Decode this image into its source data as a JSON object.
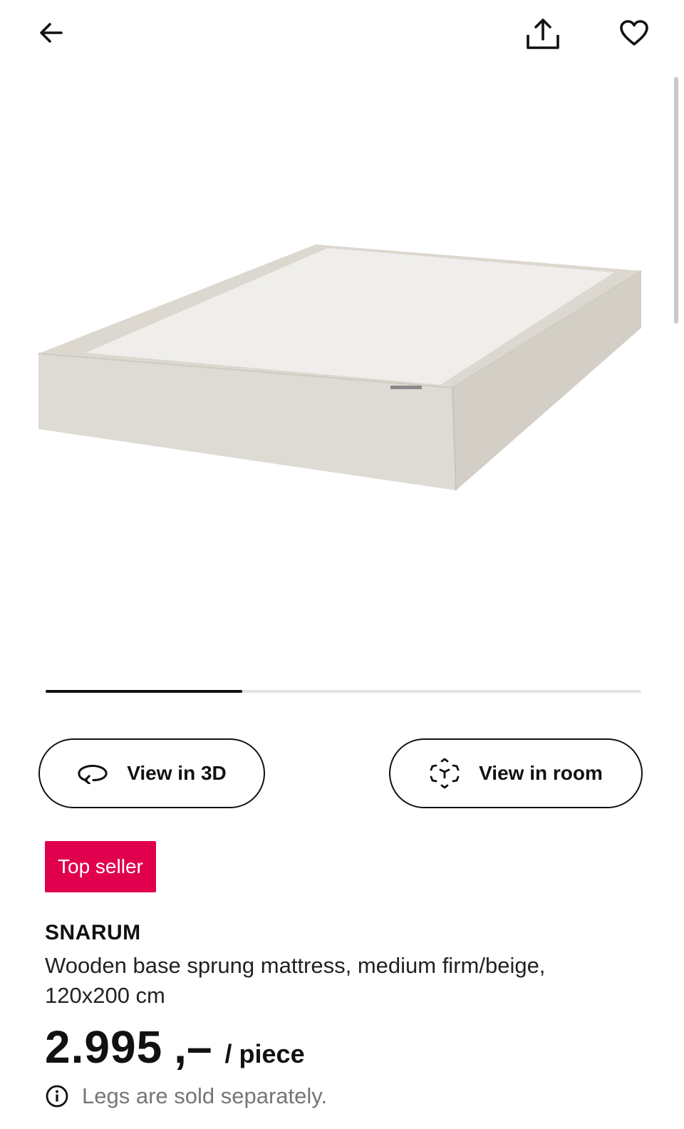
{
  "header": {
    "back_icon": "arrow-left-icon",
    "share_icon": "share-upload-icon",
    "favorite_icon": "heart-outline-icon"
  },
  "gallery": {
    "image_alt": "",
    "progress_fraction": 0.33
  },
  "actions": {
    "view_3d_label": "View in 3D",
    "view_3d_icon": "rotate-3d-icon",
    "view_room_label": "View in room",
    "view_room_icon": "ar-cube-icon"
  },
  "badge": {
    "label": "Top seller",
    "color": "#e0004d"
  },
  "product": {
    "name": "SNARUM",
    "description": "Wooden base sprung mattress, medium firm/beige, 120x200 cm",
    "price_amount": "2.995",
    "price_suffix": ",–",
    "price_unit": "/ piece",
    "note_icon": "info-icon",
    "note": "Legs are sold separately."
  }
}
